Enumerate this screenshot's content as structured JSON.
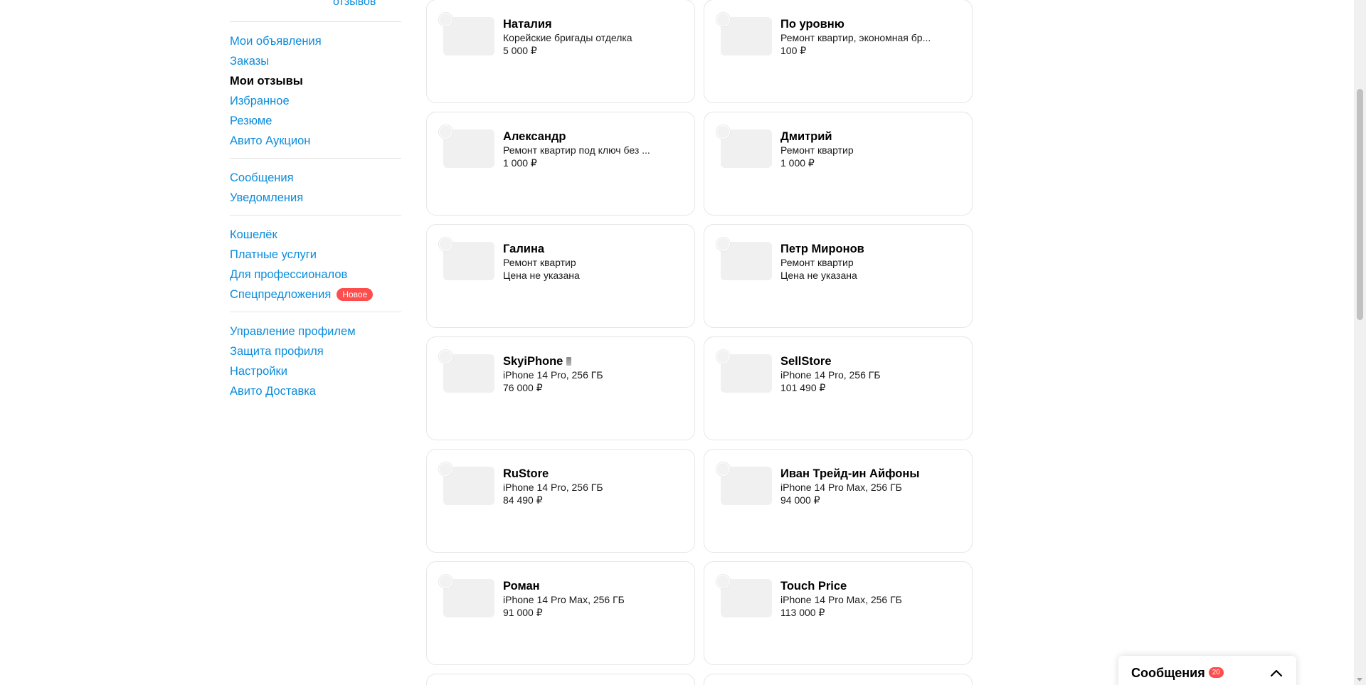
{
  "sidebar": {
    "top_link": "отзывов",
    "groups": [
      {
        "items": [
          {
            "label": "Мои объявления",
            "active": false
          },
          {
            "label": "Заказы",
            "active": false
          },
          {
            "label": "Мои отзывы",
            "active": true
          },
          {
            "label": "Избранное",
            "active": false
          },
          {
            "label": "Резюме",
            "active": false
          },
          {
            "label": "Авито Аукцион",
            "active": false
          }
        ]
      },
      {
        "items": [
          {
            "label": "Сообщения",
            "active": false
          },
          {
            "label": "Уведомления",
            "active": false
          }
        ]
      },
      {
        "items": [
          {
            "label": "Кошелёк",
            "active": false
          },
          {
            "label": "Платные услуги",
            "active": false
          },
          {
            "label": "Для профессионалов",
            "active": false
          },
          {
            "label": "Спецпредложения",
            "active": false,
            "badge": "Новое"
          }
        ]
      },
      {
        "items": [
          {
            "label": "Управление профилем",
            "active": false
          },
          {
            "label": "Защита профиля",
            "active": false
          },
          {
            "label": "Настройки",
            "active": false
          },
          {
            "label": "Авито Доставка",
            "active": false
          }
        ]
      }
    ]
  },
  "cards": [
    {
      "name": "Наталия",
      "desc": "Корейские бригады отделка",
      "price": "5 000 ₽"
    },
    {
      "name": "По уровню",
      "desc": "Ремонт квартир, экономная бр...",
      "price": "100 ₽"
    },
    {
      "name": "Александр",
      "desc": "Ремонт квартир под ключ без ...",
      "price": "1 000 ₽"
    },
    {
      "name": "Дмитрий",
      "desc": "Ремонт квартир",
      "price": "1 000 ₽"
    },
    {
      "name": "Галина",
      "desc": "Ремонт квартир",
      "price": "Цена не указана"
    },
    {
      "name": "Петр Миронов",
      "desc": "Ремонт квартир",
      "price": "Цена не указана"
    },
    {
      "name": "SkyiPhone",
      "desc": "iPhone 14 Pro, 256 ГБ",
      "price": "76 000 ₽",
      "verified": true
    },
    {
      "name": "SellStore",
      "desc": "iPhone 14 Pro, 256 ГБ",
      "price": "101 490 ₽"
    },
    {
      "name": "RuStore",
      "desc": "iPhone 14 Pro, 256 ГБ",
      "price": "84 490 ₽"
    },
    {
      "name": "Иван Трейд-ин Айфоны",
      "desc": "iPhone 14 Pro Max, 256 ГБ",
      "price": "94 000 ₽"
    },
    {
      "name": "Роман",
      "desc": "iPhone 14 Pro Max, 256 ГБ",
      "price": "91 000 ₽"
    },
    {
      "name": "Touch Price",
      "desc": "iPhone 14 Pro Max, 256 ГБ",
      "price": "113 000 ₽"
    }
  ],
  "messages_widget": {
    "title": "Сообщения",
    "count": "20"
  },
  "colors": {
    "link": "#0a8cdc",
    "badge": "#ff4d4d",
    "card_border": "#e6e6e6",
    "thumb": "#f0f0f0"
  },
  "icons": {
    "chevron": "chevron-up-icon",
    "verified": "verified-icon"
  }
}
